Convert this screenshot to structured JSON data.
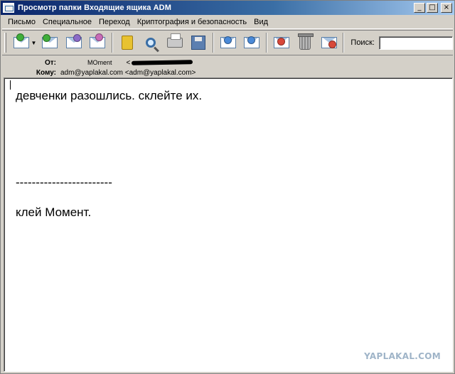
{
  "window": {
    "title": "Просмотр папки Входящие ящика ADM",
    "btn_min": "_",
    "btn_max": "□",
    "btn_close": "×"
  },
  "menu": [
    "Письмо",
    "Специальное",
    "Переход",
    "Криптография и безопасность",
    "Вид"
  ],
  "toolbar": {
    "search_label": "Поиск:",
    "search_value": "",
    "icons": [
      "receive-mail-icon",
      "reply-all-icon",
      "forward-icon",
      "new-message-icon",
      "address-book-icon",
      "find-icon",
      "print-icon",
      "save-icon",
      "move-up-icon",
      "move-down-icon",
      "delete-mark-icon",
      "trash-icon",
      "junk-icon"
    ]
  },
  "headers": {
    "from_label": "От:",
    "from_name": "MOment",
    "from_addr_prefix": "<",
    "to_label": "Кому:",
    "to_value": "adm@yaplakal.com <adm@yaplakal.com>"
  },
  "message": {
    "line1": "девченки разошлись. склейте их.",
    "separator": "------------------------",
    "line2": "клей Момент."
  },
  "watermark": "YAPLAKAL.COM",
  "colors": {
    "titlebar": "#0a246a",
    "chrome": "#d4d0c8",
    "accent": "#3a6ea5"
  }
}
